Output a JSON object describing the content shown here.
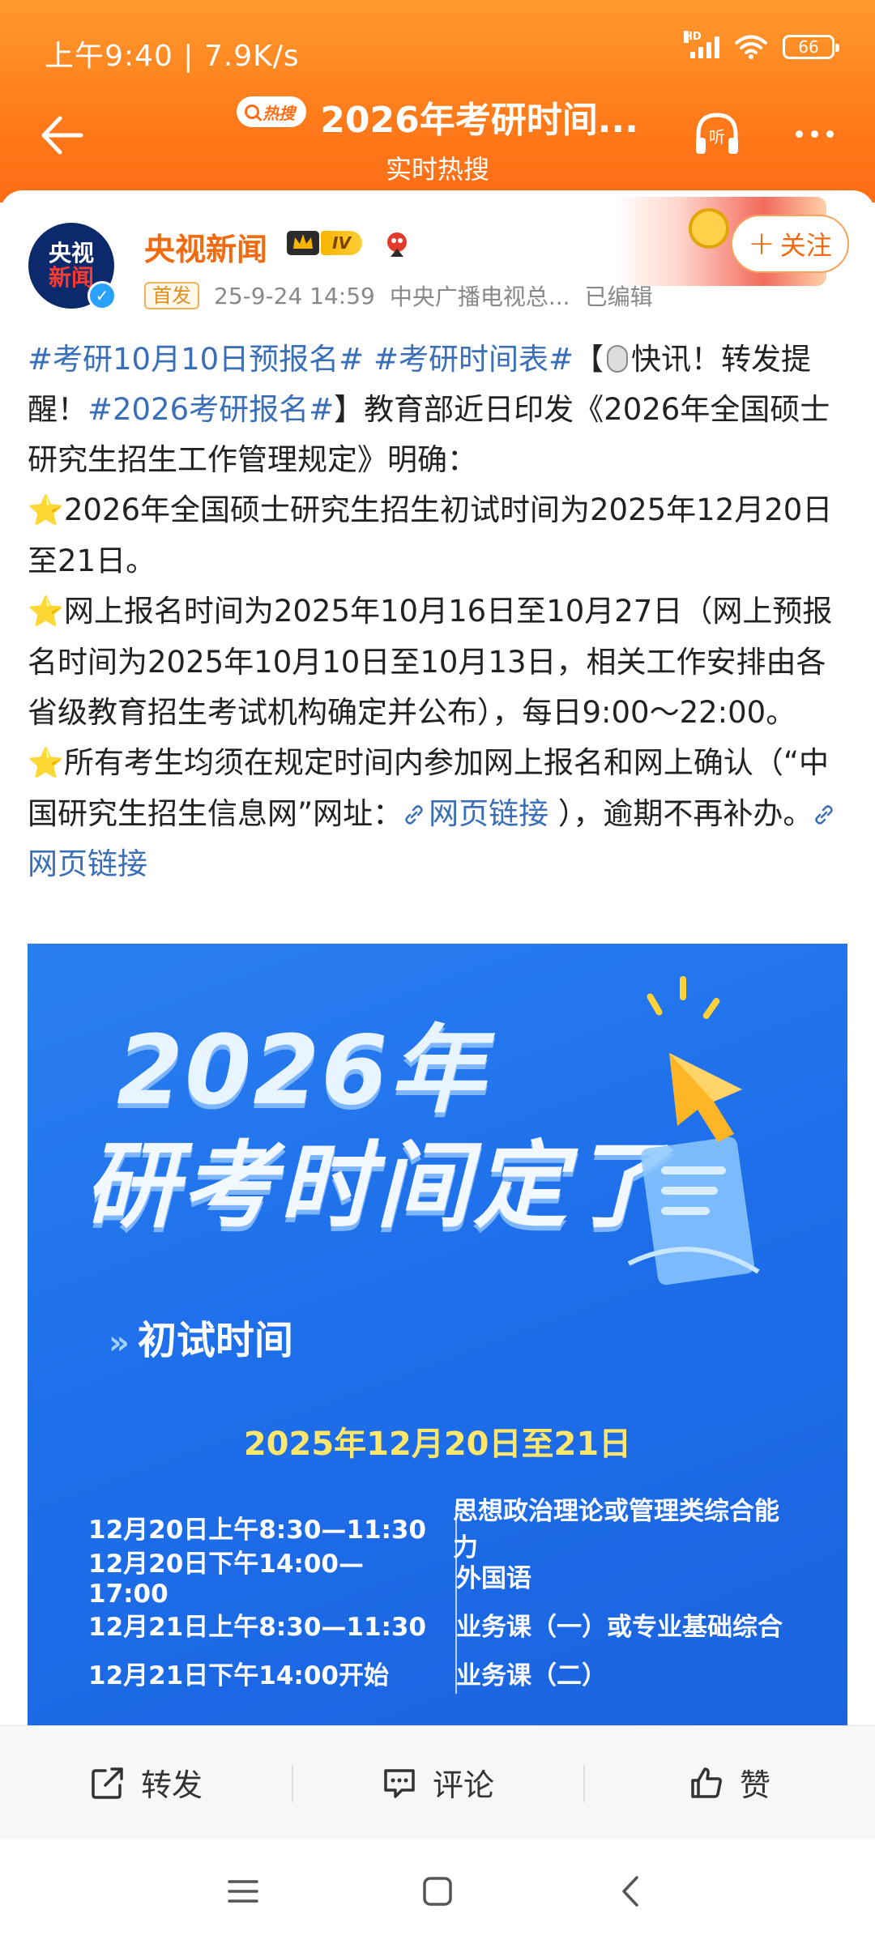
{
  "status_bar": {
    "time_speed": "上午9:40 | 7.9K/s",
    "network_label": "HD",
    "battery": "66"
  },
  "nav": {
    "hot_badge": "热搜",
    "title": "2026年考研时间...",
    "subtitle": "实时热搜"
  },
  "author": {
    "avatar_line1": "央视",
    "avatar_line2": "新闻",
    "name": "央视新闻",
    "level": "IV",
    "first_badge": "首发",
    "datetime": "25-9-24 14:59",
    "source": "中央广播电视总...",
    "edited": "已编辑",
    "follow_label": "关注"
  },
  "post": {
    "tag1": "#考研10月10日预报名#",
    "tag2": "#考研时间表#",
    "bracket_open": "【",
    "flash": "快讯！转发提醒！",
    "tag3": "#2026考研报名#",
    "intro": "】教育部近日印发《2026年全国硕士研究生招生工作管理规定》明确：",
    "point1": "2026年全国硕士研究生招生初试时间为2025年12月20日至21日。",
    "point2": "网上报名时间为2025年10月16日至10月27日（网上预报名时间为2025年10月10日至10月13日，相关工作安排由各省级教育招生考试机构确定并公布），每日9:00～22:00。",
    "point3_a": "所有考生均须在规定时间内参加网上报名和网上确认（“中国研究生招生信息网”网址：",
    "link1": "网页链接",
    "point3_b": " ），逾期不再补办。",
    "link2": "网页链接",
    "star": "⭐"
  },
  "poster": {
    "year": "2026年",
    "headline": "研考时间定了",
    "section_chev": "»",
    "section": "初试时间",
    "date_range": "2025年12月20日至21日",
    "schedule": [
      {
        "time": "12月20日上午8:30—11:30",
        "subject": "思想政治理论或管理类综合能力"
      },
      {
        "time": "12月20日下午14:00—17:00",
        "subject": "外国语"
      },
      {
        "time": "12月21日上午8:30—11:30",
        "subject": "业务课（一）或专业基础综合"
      },
      {
        "time": "12月21日下午14:00开始",
        "subject": "业务课（二）"
      }
    ]
  },
  "actions": {
    "repost": "转发",
    "comment": "评论",
    "like": "赞"
  },
  "colors": {
    "header_orange": "#ff7a1a",
    "author_orange": "#f06a0f",
    "tag_blue": "#3a6fb7",
    "poster_blue": "#1e6fea",
    "poster_yellow": "#ffe76b"
  }
}
